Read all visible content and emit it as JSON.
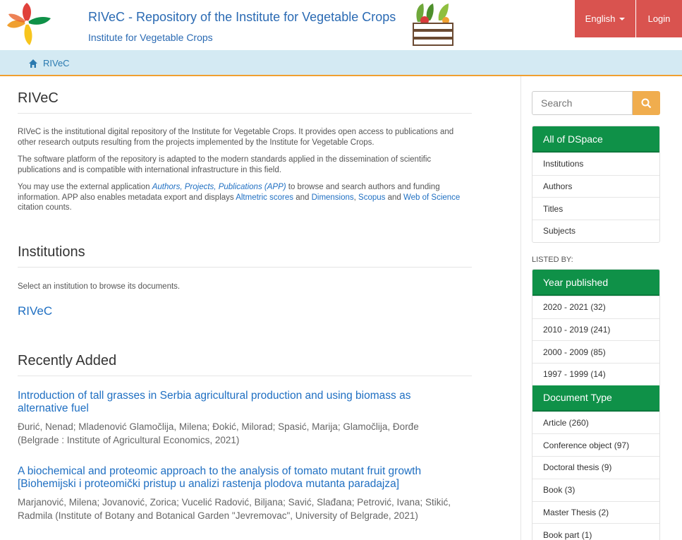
{
  "header": {
    "title": "RIVeC - Repository of the Institute for Vegetable Crops",
    "subtitle": "Institute for Vegetable Crops",
    "language_label": "English",
    "login_label": "Login",
    "brand_colors": [
      "#e0413b",
      "#f0a030",
      "#0f9148",
      "#f7c51e"
    ]
  },
  "breadcrumb": {
    "home_label": "RIVeC"
  },
  "main": {
    "heading": "RIVeC",
    "intro_p1": "RIVeC is the institutional digital repository of the Institute for Vegetable Crops. It provides open access to publications and other research outputs resulting from the projects implemented by the Institute for Vegetable Crops.",
    "intro_p2": "The software platform of the repository is adapted to the modern standards applied in the dissemination of scientific publications and is compatible with international infrastructure in this field.",
    "intro_p3": {
      "t1": "You may use the external application ",
      "app_link": "Authors, Projects, Publications (APP)",
      "t2": " to browse and search authors and funding information. APP also enables metadata export and displays ",
      "altmetric": "Altmetric scores",
      "t3": " and ",
      "dimensions": "Dimensions",
      "t4": ", ",
      "scopus": "Scopus",
      "t5": " and ",
      "wos": "Web of Science",
      "t6": " citation counts."
    },
    "institutions_heading": "Institutions",
    "institutions_text": "Select an institution to browse its documents.",
    "institution_link": "RIVeC",
    "recent_heading": "Recently Added",
    "items": [
      {
        "title": "Introduction of tall grasses in Serbia agricultural production and using biomass as alternative fuel",
        "authors": "Đurić, Nenad; Mladenović Glamočlija, Milena; Đokić, Milorad; Spasić, Marija; Glamočlija, Đorđe",
        "source": "(Belgrade : Institute of Agricultural Economics, 2021)"
      },
      {
        "title": "A biochemical and proteomic approach to the analysis of tomato mutant fruit growth [Biohemijski i proteomički pristup u analizi rastenja plodova mutanta paradajza]",
        "authors": "Marjanović, Milena; Jovanović, Zorica; Vucelić Radović, Biljana; Savić, Slađana; Petrović, Ivana; Stikić, Radmila (Institute of Botany and Botanical Garden \"Jevremovac\", University of Belgrade, 2021)",
        "source": ""
      }
    ]
  },
  "sidebar": {
    "search_placeholder": "Search",
    "search_icon": "search-icon",
    "dspace_heading": "All of DSpace",
    "dspace_items": [
      "Institutions",
      "Authors",
      "Titles",
      "Subjects"
    ],
    "listed_by": "LISTED BY:",
    "year_heading": "Year published",
    "year_items": [
      "2020 - 2021 (32)",
      "2010 - 2019 (241)",
      "2000 - 2009 (85)",
      "1997 - 1999 (14)"
    ],
    "doctype_heading": "Document Type",
    "doctype_items": [
      "Article (260)",
      "Conference object (97)",
      "Doctoral thesis (9)",
      "Book (3)",
      "Master Thesis (2)",
      "Book part (1)"
    ]
  }
}
